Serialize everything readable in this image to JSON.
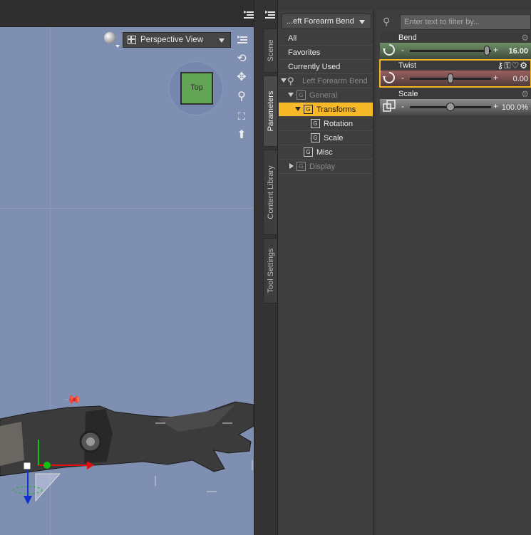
{
  "viewport": {
    "view_label": "Perspective View",
    "cube_label": "Top"
  },
  "tabs": [
    "Scene",
    "Parameters",
    "Content Library",
    "Tool Settings"
  ],
  "categories": {
    "node_selector": "...eft Forearm Bend",
    "items": [
      {
        "label": "All"
      },
      {
        "label": "Favorites"
      },
      {
        "label": "Currently Used"
      },
      {
        "label": "Left Forearm Bend"
      },
      {
        "label": "General"
      },
      {
        "label": "Transforms"
      },
      {
        "label": "Rotation"
      },
      {
        "label": "Scale"
      },
      {
        "label": "Misc"
      },
      {
        "label": "Display"
      }
    ],
    "group_icon_letter": "G"
  },
  "params": {
    "search_placeholder": "Enter text to filter by...",
    "items": [
      {
        "name": "Bend",
        "value": "16.00",
        "slider_fraction": 0.95
      },
      {
        "name": "Twist",
        "value": "0.00",
        "slider_fraction": 0.5
      },
      {
        "name": "Scale",
        "value": "100.0%",
        "slider_fraction": 0.5
      }
    ],
    "minus": "-",
    "plus": "+"
  },
  "colors": {
    "viewport_bg": "#7e8fb1",
    "selection": "#f7b928",
    "cube": "#62a555",
    "bend_slider": "#6d8f66",
    "twist_slider": "#9b6060"
  }
}
